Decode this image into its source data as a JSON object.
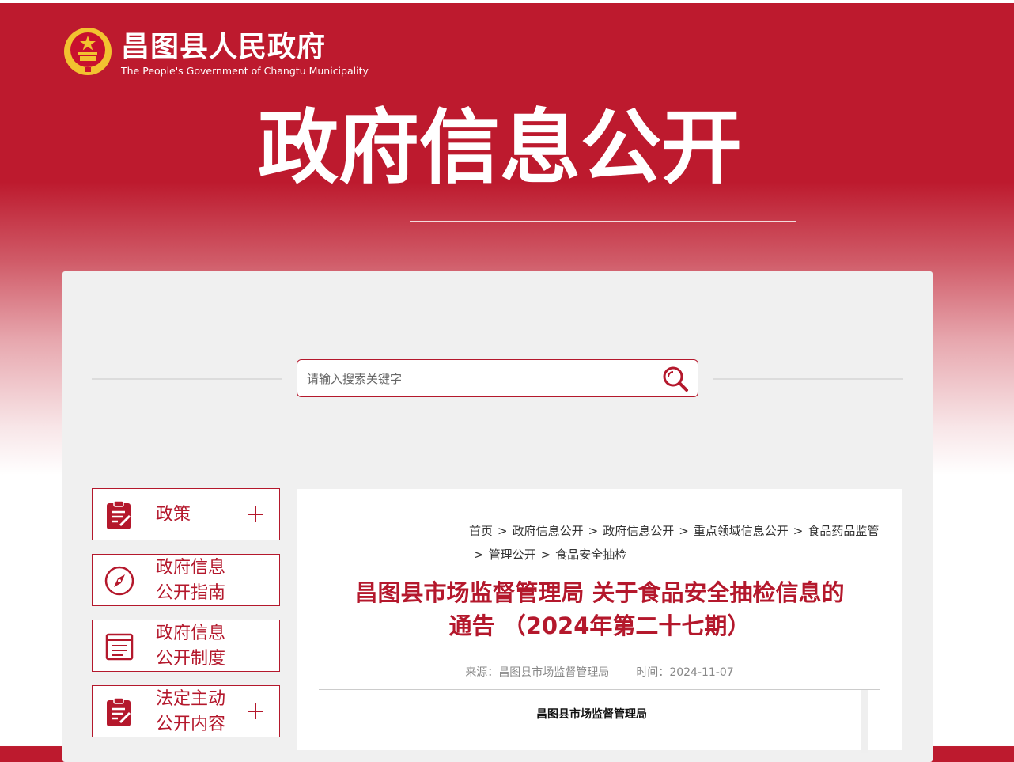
{
  "header": {
    "site_title": "昌图县人民政府",
    "site_subtitle": "The People's Government of Changtu Municipality",
    "emblem_icon": "national-emblem-icon",
    "hero_title": "政府信息公开"
  },
  "search": {
    "placeholder": "请输入搜索关键字",
    "value": "",
    "icon": "search-icon"
  },
  "sidebar": {
    "items": [
      {
        "label": "政策",
        "icon": "clipboard-edit-icon",
        "expandable": true
      },
      {
        "label_line1": "政府信息",
        "label_line2": "公开指南",
        "icon": "compass-icon",
        "expandable": false
      },
      {
        "label_line1": "政府信息",
        "label_line2": "公开制度",
        "icon": "document-list-icon",
        "expandable": false
      },
      {
        "label_line1": "法定主动",
        "label_line2": "公开内容",
        "icon": "clipboard-edit-icon",
        "expandable": true
      }
    ]
  },
  "breadcrumb": {
    "items": [
      "首页",
      "政府信息公开",
      "政府信息公开",
      "重点领域信息公开",
      "食品药品监管",
      "管理公开",
      "食品安全抽检"
    ],
    "separator": ">"
  },
  "article": {
    "title_line1": "昌图县市场监督管理局 关于食品安全抽检信息的",
    "title_line2": "通告 （2024年第二十七期）",
    "source_label": "来源：",
    "source": "昌图县市场监督管理局",
    "time_label": "时间：",
    "time": "2024-11-07",
    "document_org": "昌图县市场监督管理局"
  },
  "colors": {
    "brand_red": "#bd1a2e",
    "accent_red": "#b4182c",
    "panel_bg": "#f0f0f0"
  }
}
